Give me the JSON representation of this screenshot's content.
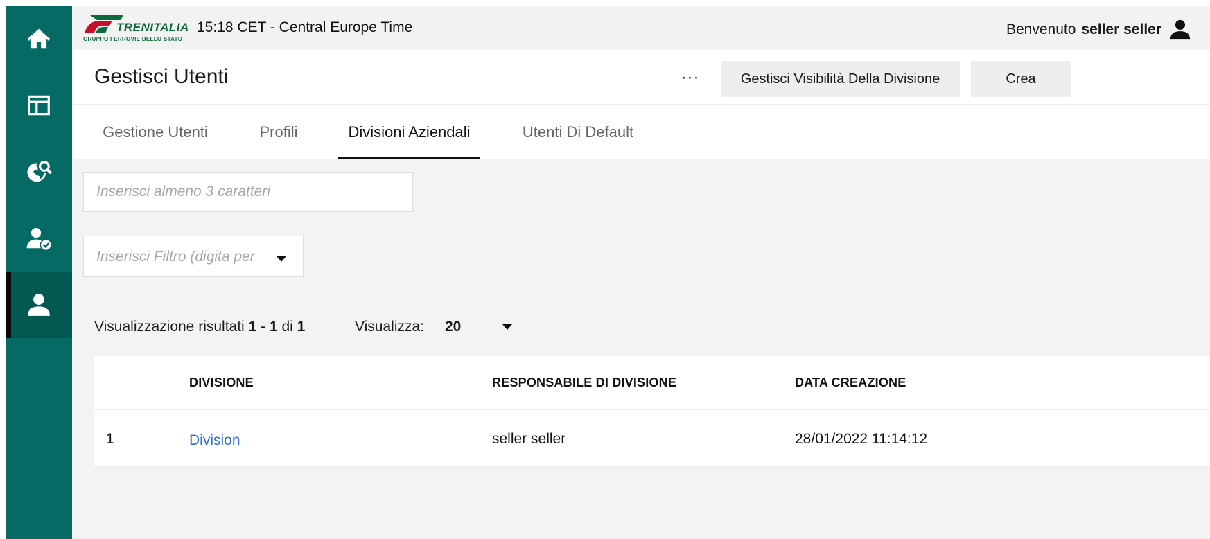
{
  "sidebar": {
    "items": [
      {
        "name": "home",
        "icon": "home-icon",
        "active": false
      },
      {
        "name": "dashboard",
        "icon": "layout-icon",
        "active": false
      },
      {
        "name": "world-search",
        "icon": "globe-search-icon",
        "active": false
      },
      {
        "name": "user-verified",
        "icon": "user-check-icon",
        "active": false
      },
      {
        "name": "users",
        "icon": "user-icon",
        "active": true
      }
    ],
    "color": "#046a63"
  },
  "header": {
    "logo_text": "TRENITALIA",
    "logo_subtext": "GRUPPO FERROVIE DELLO STATO",
    "clock": "15:18 CET - Central Europe Time",
    "welcome_label": "Benvenuto",
    "user_name": "seller seller"
  },
  "titlebar": {
    "title": "Gestisci Utenti",
    "more_label": "···",
    "visibility_button": "Gestisci Visibilità Della Divisione",
    "create_button": "Crea"
  },
  "tabs": [
    {
      "label": "Gestione Utenti",
      "active": false
    },
    {
      "label": "Profili",
      "active": false
    },
    {
      "label": "Divisioni Aziendali",
      "active": true
    },
    {
      "label": "Utenti Di Default",
      "active": false
    }
  ],
  "filters": {
    "search_placeholder": "Inserisci almeno 3 caratteri",
    "filter_placeholder": "Inserisci Filtro (digita per"
  },
  "results": {
    "prefix": "Visualizzazione risultati",
    "from": "1",
    "sep": "-",
    "to": "1",
    "of_label": "di",
    "total": "1",
    "per_page_label": "Visualizza:",
    "per_page_value": "20"
  },
  "table": {
    "columns": [
      "DIVISIONE",
      "RESPONSABILE DI DIVISIONE",
      "DATA CREAZIONE"
    ],
    "rows": [
      {
        "index": "1",
        "division": "Division",
        "manager": "seller seller",
        "created": "28/01/2022 11:14:12"
      }
    ]
  },
  "colors": {
    "brand": "#046a63",
    "link": "#2f6fd6",
    "logo": "#0f6b3a"
  }
}
